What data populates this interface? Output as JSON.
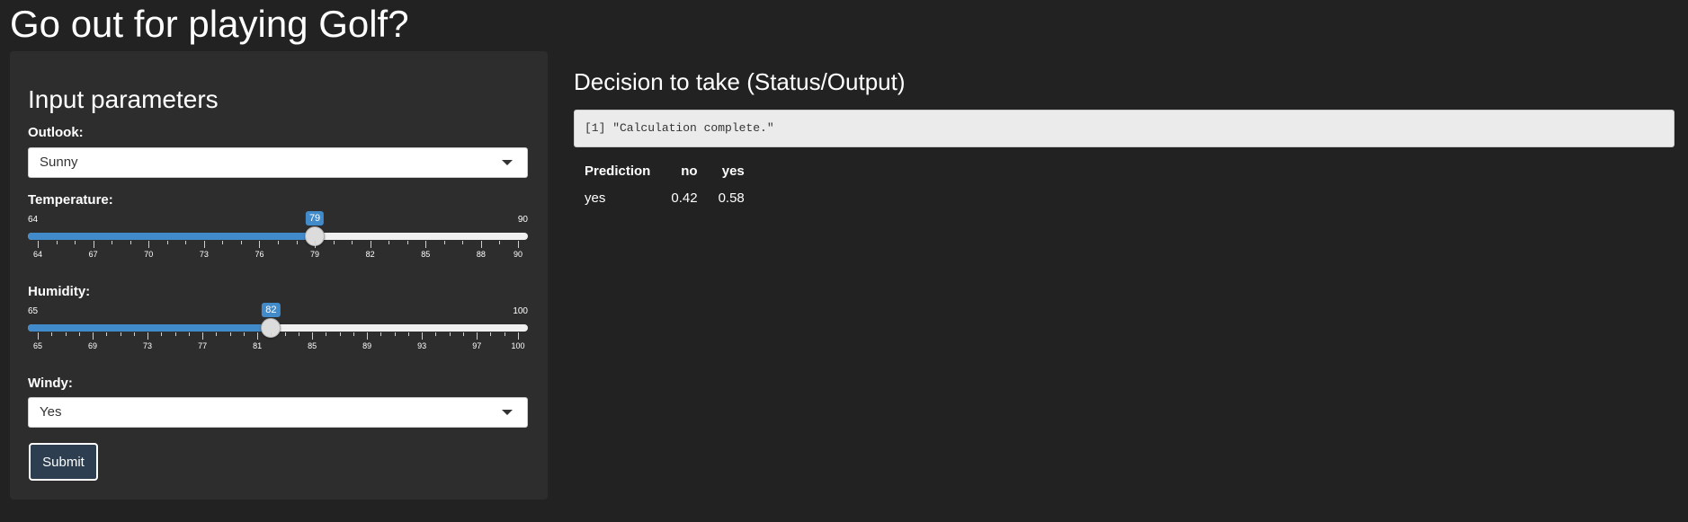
{
  "app": {
    "title": "Go out for playing Golf?"
  },
  "sidebar": {
    "title": "Input parameters",
    "outlook": {
      "label": "Outlook:",
      "value": "Sunny"
    },
    "temperature": {
      "label": "Temperature:",
      "min": 64,
      "max": 90,
      "value": 79,
      "min_label": "64",
      "max_label": "90",
      "value_label": "79",
      "ticks": [
        "64",
        "67",
        "70",
        "73",
        "76",
        "79",
        "82",
        "85",
        "88",
        "90"
      ]
    },
    "humidity": {
      "label": "Humidity:",
      "min": 65,
      "max": 100,
      "value": 82,
      "min_label": "65",
      "max_label": "100",
      "value_label": "82",
      "ticks": [
        "65",
        "69",
        "73",
        "77",
        "81",
        "85",
        "89",
        "93",
        "97",
        "100"
      ]
    },
    "windy": {
      "label": "Windy:",
      "value": "Yes"
    },
    "submit_label": "Submit"
  },
  "main": {
    "title": "Decision to take (Status/Output)",
    "status_text": "[1] \"Calculation complete.\"",
    "table": {
      "headers": [
        "Prediction",
        "no",
        "yes"
      ],
      "rows": [
        [
          "yes",
          "0.42",
          "0.58"
        ]
      ]
    }
  },
  "colors": {
    "accent": "#428bca",
    "button": "#2c3e50",
    "background": "#222222",
    "panel": "#2d2d2d"
  }
}
